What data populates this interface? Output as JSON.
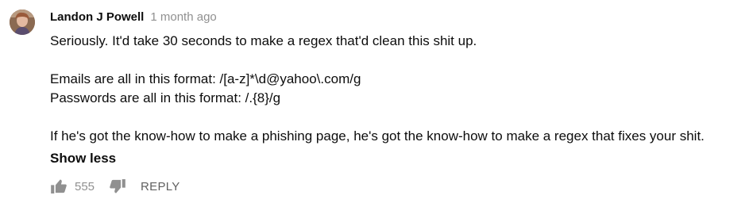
{
  "comment": {
    "author": "Landon J Powell",
    "timestamp": "1 month ago",
    "avatar_icon": "user-avatar",
    "lines": [
      "Seriously. It'd take 30 seconds to make a regex that'd clean this shit up.",
      "",
      "Emails are all in this format: /[a-z]*\\d@yahoo\\.com/g",
      "Passwords are all in this format: /.{8}/g",
      "",
      "If he's got the know-how to make a phishing page, he's got the know-how to make a regex that fixes your shit."
    ],
    "show_less_label": "Show less",
    "like_count": "555",
    "like_icon": "thumbs-up-icon",
    "dislike_icon": "thumbs-down-icon",
    "reply_label": "REPLY"
  },
  "colors": {
    "text": "#0d0d0d",
    "secondary": "#909090",
    "icon": "#909090",
    "reply": "#606060"
  }
}
